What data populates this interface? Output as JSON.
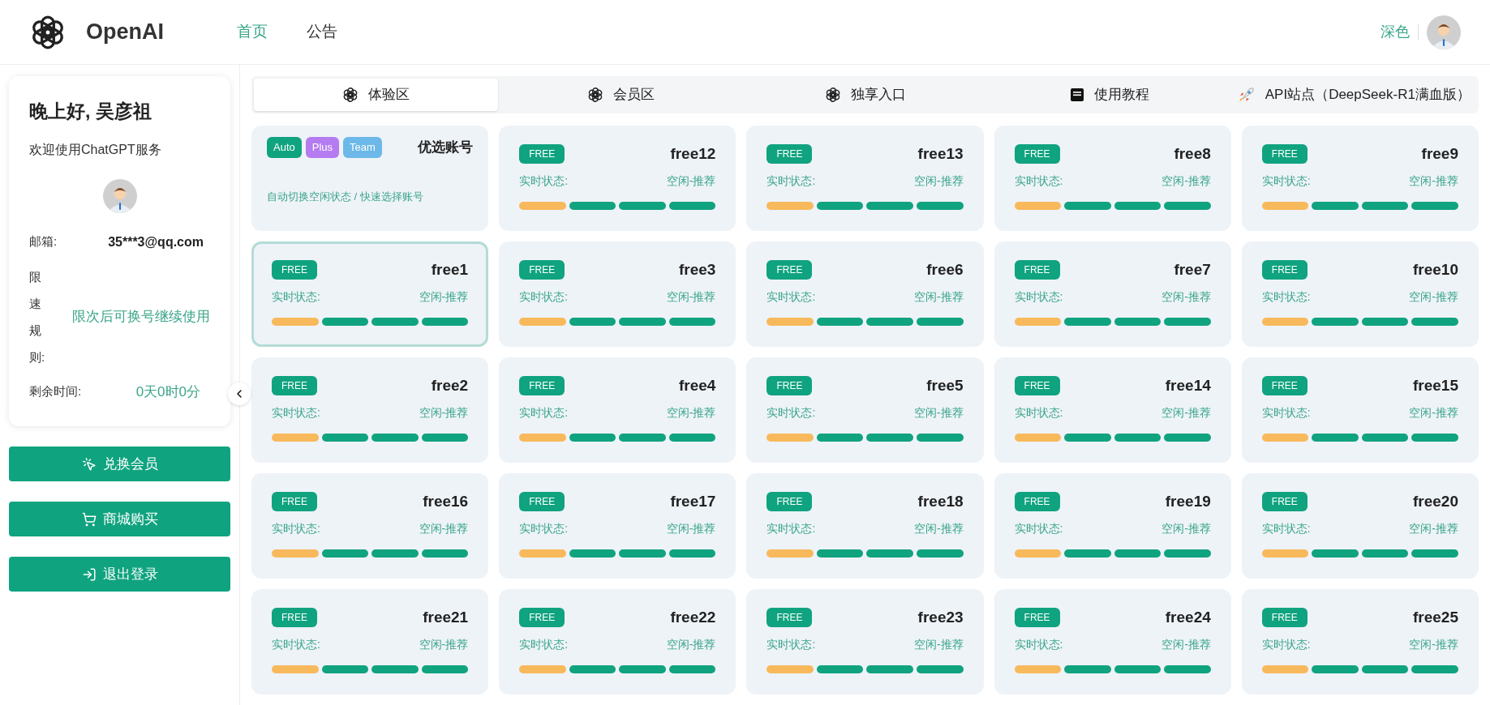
{
  "header": {
    "brand": "OpenAI",
    "nav": [
      {
        "label": "首页",
        "selected": true
      },
      {
        "label": "公告",
        "selected": false
      }
    ],
    "theme_toggle": "深色"
  },
  "sidebar": {
    "greeting": "晚上好, 吴彦祖",
    "welcome": "欢迎使用ChatGPT服务",
    "fields": [
      {
        "kind": "plain",
        "label": "邮箱:",
        "value": "35***3@qq.com"
      },
      {
        "kind": "stacked",
        "label": "限速规则:",
        "value": "限次后可换号继续使用"
      },
      {
        "kind": "accent",
        "label": "剩余时间:",
        "value": "0天0时0分"
      }
    ],
    "buttons": [
      {
        "kind": "redeem",
        "label": "兑换会员"
      },
      {
        "kind": "shop",
        "label": "商城购买"
      },
      {
        "kind": "logout",
        "label": "退出登录"
      }
    ]
  },
  "tabs": [
    {
      "kind": "openai",
      "label": "体验区",
      "selected": true
    },
    {
      "kind": "openai",
      "label": "会员区",
      "selected": false
    },
    {
      "kind": "openai",
      "label": "独享入口",
      "selected": false
    },
    {
      "kind": "guide",
      "label": "使用教程",
      "selected": false
    },
    {
      "kind": "rocket",
      "label": "API站点（DeepSeek-R1满血版）",
      "selected": false
    }
  ],
  "auto_card": {
    "badges": [
      {
        "label": "Auto",
        "color": "#10a37f"
      },
      {
        "label": "Plus",
        "color": "#b57bf0"
      },
      {
        "label": "Team",
        "color": "#6cb8e8"
      }
    ],
    "title": "优选账号",
    "subtitle": "自动切换空闲状态 / 快速选择账号"
  },
  "cards": [
    {
      "badge": "FREE",
      "name": "free12",
      "status_label": "实时状态:",
      "status": "空闲-推荐",
      "selected": false,
      "bars": [
        {
          "color": "#f8b95c"
        },
        {
          "color": "#10a37f"
        },
        {
          "color": "#10a37f"
        },
        {
          "color": "#10a37f"
        }
      ]
    },
    {
      "badge": "FREE",
      "name": "free13",
      "status_label": "实时状态:",
      "status": "空闲-推荐",
      "selected": false,
      "bars": [
        {
          "color": "#f8b95c"
        },
        {
          "color": "#10a37f"
        },
        {
          "color": "#10a37f"
        },
        {
          "color": "#10a37f"
        }
      ]
    },
    {
      "badge": "FREE",
      "name": "free8",
      "status_label": "实时状态:",
      "status": "空闲-推荐",
      "selected": false,
      "bars": [
        {
          "color": "#f8b95c"
        },
        {
          "color": "#10a37f"
        },
        {
          "color": "#10a37f"
        },
        {
          "color": "#10a37f"
        }
      ]
    },
    {
      "badge": "FREE",
      "name": "free9",
      "status_label": "实时状态:",
      "status": "空闲-推荐",
      "selected": false,
      "bars": [
        {
          "color": "#f8b95c"
        },
        {
          "color": "#10a37f"
        },
        {
          "color": "#10a37f"
        },
        {
          "color": "#10a37f"
        }
      ]
    },
    {
      "badge": "FREE",
      "name": "free1",
      "status_label": "实时状态:",
      "status": "空闲-推荐",
      "selected": true,
      "bars": [
        {
          "color": "#f8b95c"
        },
        {
          "color": "#10a37f"
        },
        {
          "color": "#10a37f"
        },
        {
          "color": "#10a37f"
        }
      ]
    },
    {
      "badge": "FREE",
      "name": "free3",
      "status_label": "实时状态:",
      "status": "空闲-推荐",
      "selected": false,
      "bars": [
        {
          "color": "#f8b95c"
        },
        {
          "color": "#10a37f"
        },
        {
          "color": "#10a37f"
        },
        {
          "color": "#10a37f"
        }
      ]
    },
    {
      "badge": "FREE",
      "name": "free6",
      "status_label": "实时状态:",
      "status": "空闲-推荐",
      "selected": false,
      "bars": [
        {
          "color": "#f8b95c"
        },
        {
          "color": "#10a37f"
        },
        {
          "color": "#10a37f"
        },
        {
          "color": "#10a37f"
        }
      ]
    },
    {
      "badge": "FREE",
      "name": "free7",
      "status_label": "实时状态:",
      "status": "空闲-推荐",
      "selected": false,
      "bars": [
        {
          "color": "#f8b95c"
        },
        {
          "color": "#10a37f"
        },
        {
          "color": "#10a37f"
        },
        {
          "color": "#10a37f"
        }
      ]
    },
    {
      "badge": "FREE",
      "name": "free10",
      "status_label": "实时状态:",
      "status": "空闲-推荐",
      "selected": false,
      "bars": [
        {
          "color": "#f8b95c"
        },
        {
          "color": "#10a37f"
        },
        {
          "color": "#10a37f"
        },
        {
          "color": "#10a37f"
        }
      ]
    },
    {
      "badge": "FREE",
      "name": "free2",
      "status_label": "实时状态:",
      "status": "空闲-推荐",
      "selected": false,
      "bars": [
        {
          "color": "#f8b95c"
        },
        {
          "color": "#10a37f"
        },
        {
          "color": "#10a37f"
        },
        {
          "color": "#10a37f"
        }
      ]
    },
    {
      "badge": "FREE",
      "name": "free4",
      "status_label": "实时状态:",
      "status": "空闲-推荐",
      "selected": false,
      "bars": [
        {
          "color": "#f8b95c"
        },
        {
          "color": "#10a37f"
        },
        {
          "color": "#10a37f"
        },
        {
          "color": "#10a37f"
        }
      ]
    },
    {
      "badge": "FREE",
      "name": "free5",
      "status_label": "实时状态:",
      "status": "空闲-推荐",
      "selected": false,
      "bars": [
        {
          "color": "#f8b95c"
        },
        {
          "color": "#10a37f"
        },
        {
          "color": "#10a37f"
        },
        {
          "color": "#10a37f"
        }
      ]
    },
    {
      "badge": "FREE",
      "name": "free14",
      "status_label": "实时状态:",
      "status": "空闲-推荐",
      "selected": false,
      "bars": [
        {
          "color": "#f8b95c"
        },
        {
          "color": "#10a37f"
        },
        {
          "color": "#10a37f"
        },
        {
          "color": "#10a37f"
        }
      ]
    },
    {
      "badge": "FREE",
      "name": "free15",
      "status_label": "实时状态:",
      "status": "空闲-推荐",
      "selected": false,
      "bars": [
        {
          "color": "#f8b95c"
        },
        {
          "color": "#10a37f"
        },
        {
          "color": "#10a37f"
        },
        {
          "color": "#10a37f"
        }
      ]
    },
    {
      "badge": "FREE",
      "name": "free16",
      "status_label": "实时状态:",
      "status": "空闲-推荐",
      "selected": false,
      "bars": [
        {
          "color": "#f8b95c"
        },
        {
          "color": "#10a37f"
        },
        {
          "color": "#10a37f"
        },
        {
          "color": "#10a37f"
        }
      ]
    },
    {
      "badge": "FREE",
      "name": "free17",
      "status_label": "实时状态:",
      "status": "空闲-推荐",
      "selected": false,
      "bars": [
        {
          "color": "#f8b95c"
        },
        {
          "color": "#10a37f"
        },
        {
          "color": "#10a37f"
        },
        {
          "color": "#10a37f"
        }
      ]
    },
    {
      "badge": "FREE",
      "name": "free18",
      "status_label": "实时状态:",
      "status": "空闲-推荐",
      "selected": false,
      "bars": [
        {
          "color": "#f8b95c"
        },
        {
          "color": "#10a37f"
        },
        {
          "color": "#10a37f"
        },
        {
          "color": "#10a37f"
        }
      ]
    },
    {
      "badge": "FREE",
      "name": "free19",
      "status_label": "实时状态:",
      "status": "空闲-推荐",
      "selected": false,
      "bars": [
        {
          "color": "#f8b95c"
        },
        {
          "color": "#10a37f"
        },
        {
          "color": "#10a37f"
        },
        {
          "color": "#10a37f"
        }
      ]
    },
    {
      "badge": "FREE",
      "name": "free20",
      "status_label": "实时状态:",
      "status": "空闲-推荐",
      "selected": false,
      "bars": [
        {
          "color": "#f8b95c"
        },
        {
          "color": "#10a37f"
        },
        {
          "color": "#10a37f"
        },
        {
          "color": "#10a37f"
        }
      ]
    },
    {
      "badge": "FREE",
      "name": "free21",
      "status_label": "实时状态:",
      "status": "空闲-推荐",
      "selected": false,
      "bars": [
        {
          "color": "#f8b95c"
        },
        {
          "color": "#10a37f"
        },
        {
          "color": "#10a37f"
        },
        {
          "color": "#10a37f"
        }
      ]
    },
    {
      "badge": "FREE",
      "name": "free22",
      "status_label": "实时状态:",
      "status": "空闲-推荐",
      "selected": false,
      "bars": [
        {
          "color": "#f8b95c"
        },
        {
          "color": "#10a37f"
        },
        {
          "color": "#10a37f"
        },
        {
          "color": "#10a37f"
        }
      ]
    },
    {
      "badge": "FREE",
      "name": "free23",
      "status_label": "实时状态:",
      "status": "空闲-推荐",
      "selected": false,
      "bars": [
        {
          "color": "#f8b95c"
        },
        {
          "color": "#10a37f"
        },
        {
          "color": "#10a37f"
        },
        {
          "color": "#10a37f"
        }
      ]
    },
    {
      "badge": "FREE",
      "name": "free24",
      "status_label": "实时状态:",
      "status": "空闲-推荐",
      "selected": false,
      "bars": [
        {
          "color": "#f8b95c"
        },
        {
          "color": "#10a37f"
        },
        {
          "color": "#10a37f"
        },
        {
          "color": "#10a37f"
        }
      ]
    },
    {
      "badge": "FREE",
      "name": "free25",
      "status_label": "实时状态:",
      "status": "空闲-推荐",
      "selected": false,
      "bars": [
        {
          "color": "#f8b95c"
        },
        {
          "color": "#10a37f"
        },
        {
          "color": "#10a37f"
        },
        {
          "color": "#10a37f"
        }
      ]
    }
  ]
}
